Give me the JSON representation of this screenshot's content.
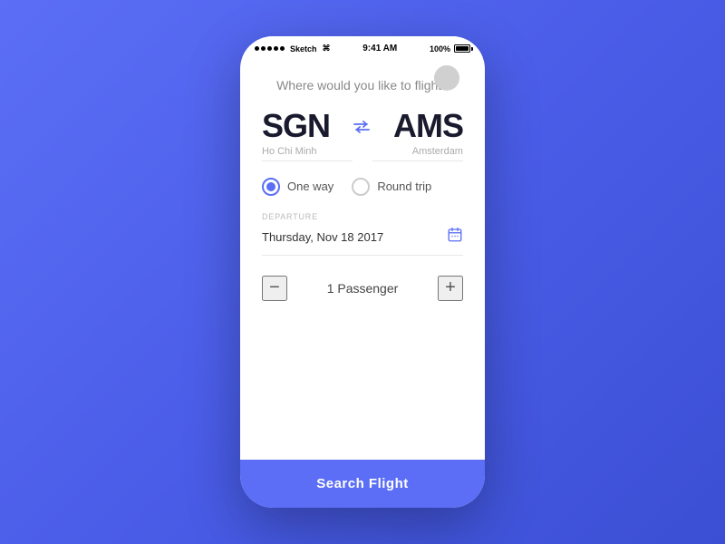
{
  "statusBar": {
    "time": "9:41 AM",
    "battery": "100%",
    "signal": "●●●●●",
    "wifi": "wifi"
  },
  "header": {
    "question": "Where would you like to flight?"
  },
  "airports": {
    "origin": {
      "code": "SGN",
      "name": "Ho Chi Minh"
    },
    "destination": {
      "code": "AMS",
      "name": "Amsterdam"
    }
  },
  "tripTypes": [
    {
      "id": "one-way",
      "label": "One way",
      "selected": true
    },
    {
      "id": "round-trip",
      "label": "Round trip",
      "selected": false
    }
  ],
  "departure": {
    "label": "DEPARTURE",
    "date": "Thursday, Nov 18 2017"
  },
  "passengers": {
    "count": 1,
    "label": "1 Passenger",
    "decrementLabel": "−",
    "incrementLabel": "+"
  },
  "searchButton": {
    "label": "Search Flight"
  }
}
